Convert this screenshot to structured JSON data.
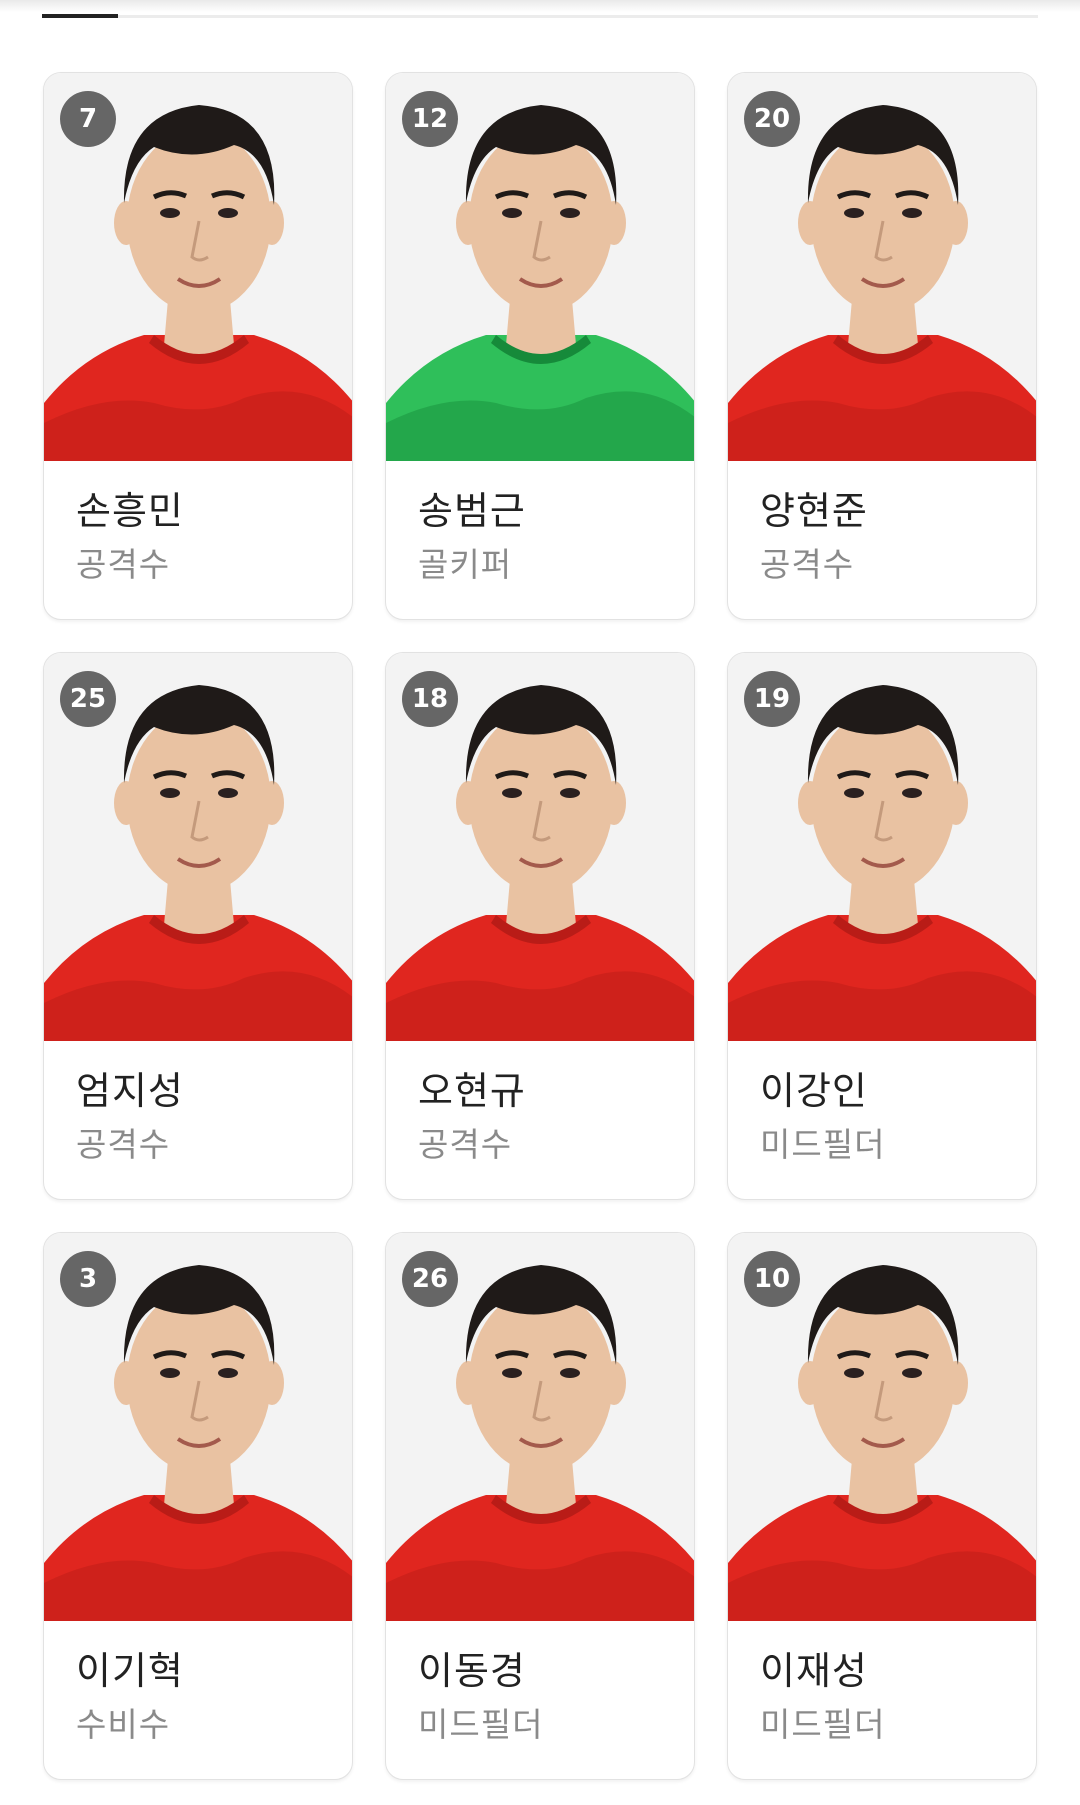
{
  "tab_indicator": "",
  "players": [
    {
      "number": "7",
      "name": "손흥민",
      "position": "공격수",
      "kit": "red"
    },
    {
      "number": "12",
      "name": "송범근",
      "position": "골키퍼",
      "kit": "green"
    },
    {
      "number": "20",
      "name": "양현준",
      "position": "공격수",
      "kit": "red"
    },
    {
      "number": "25",
      "name": "엄지성",
      "position": "공격수",
      "kit": "red"
    },
    {
      "number": "18",
      "name": "오현규",
      "position": "공격수",
      "kit": "red"
    },
    {
      "number": "19",
      "name": "이강인",
      "position": "미드필더",
      "kit": "red"
    },
    {
      "number": "3",
      "name": "이기혁",
      "position": "수비수",
      "kit": "red"
    },
    {
      "number": "26",
      "name": "이동경",
      "position": "미드필더",
      "kit": "red"
    },
    {
      "number": "10",
      "name": "이재성",
      "position": "미드필더",
      "kit": "red"
    }
  ],
  "colors": {
    "red_kit": "#e0261f",
    "red_kit_dark": "#b91c17",
    "green_kit": "#2fbf5a",
    "green_kit_dark": "#168a3a",
    "badge": "#666666",
    "skin": "#e9c2a2",
    "hair": "#1f1a18"
  }
}
